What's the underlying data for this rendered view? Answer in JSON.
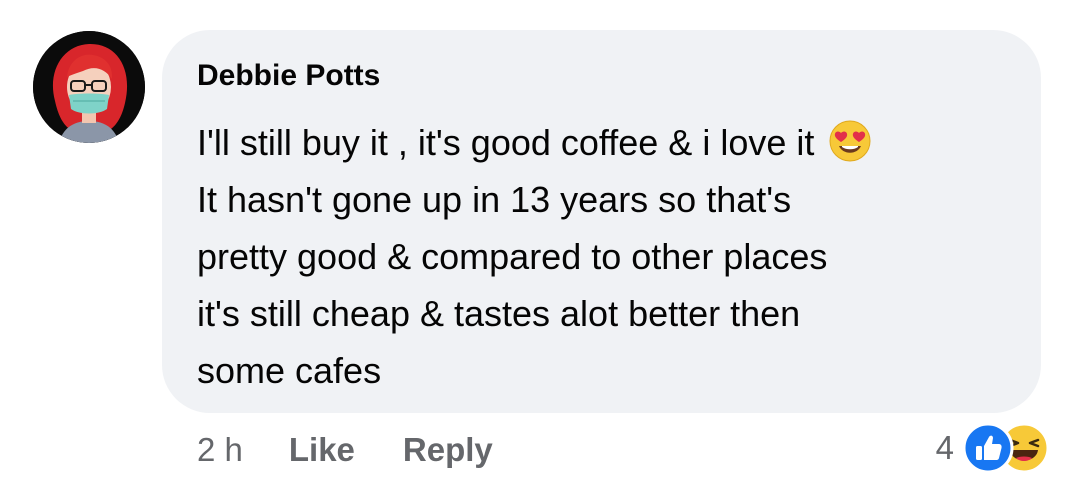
{
  "comment": {
    "author": "Debbie Potts",
    "lines": [
      "I'll still buy it , it's good coffee & i love it",
      "It hasn't gone up in 13 years so that's",
      "pretty good & compared to other places",
      "it's still cheap & tastes alot better then",
      "some cafes"
    ],
    "inline_emoji": "heart-eyes-emoji"
  },
  "actions": {
    "time": "2 h",
    "like_label": "Like",
    "reply_label": "Reply"
  },
  "reactions": {
    "count": "4",
    "icons": [
      "like-reaction-icon",
      "haha-reaction-icon"
    ]
  },
  "colors": {
    "bubble_bg": "#f0f2f5",
    "text": "#050505",
    "meta_text": "#65676b",
    "like_blue": "#1877f2",
    "haha_yellow": "#f7c938"
  }
}
